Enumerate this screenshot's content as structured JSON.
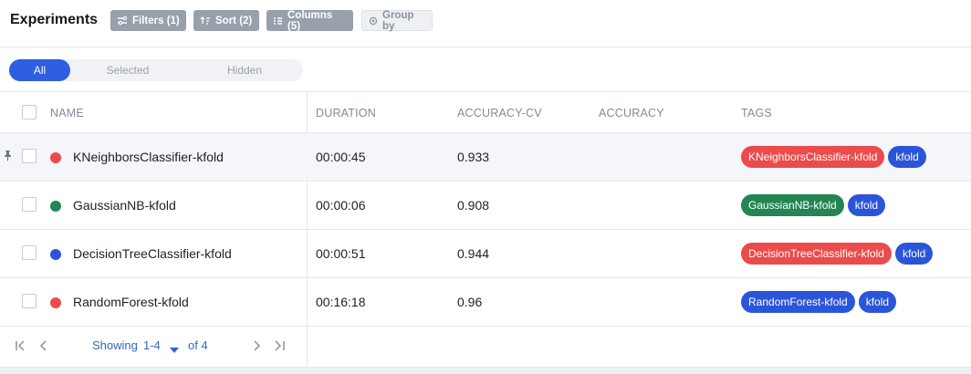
{
  "header": {
    "title": "Experiments",
    "filters_label": "Filters (1)",
    "sort_label": "Sort (2)",
    "columns_label": "Columns (5)",
    "group_by_label": "Group by"
  },
  "segment": {
    "all": "All",
    "selected": "Selected",
    "hidden": "Hidden",
    "active": "All"
  },
  "columns": {
    "name": "NAME",
    "duration": "DURATION",
    "accuracy_cv": "ACCURACY-CV",
    "accuracy": "ACCURACY",
    "tags": "TAGS"
  },
  "rows": [
    {
      "name": "KNeighborsClassifier-kfold",
      "duration": "00:00:45",
      "accuracy_cv": "0.933",
      "accuracy": "",
      "dot_color": "#eb4b4b",
      "pinned": true,
      "tags": [
        {
          "text": "KNeighborsClassifier-kfold",
          "color": "red"
        },
        {
          "text": "kfold",
          "color": "blue"
        }
      ]
    },
    {
      "name": "GaussianNB-kfold",
      "duration": "00:00:06",
      "accuracy_cv": "0.908",
      "accuracy": "",
      "dot_color": "#238553",
      "pinned": false,
      "tags": [
        {
          "text": "GaussianNB-kfold",
          "color": "green"
        },
        {
          "text": "kfold",
          "color": "blue"
        }
      ]
    },
    {
      "name": "DecisionTreeClassifier-kfold",
      "duration": "00:00:51",
      "accuracy_cv": "0.944",
      "accuracy": "",
      "dot_color": "#2b55d9",
      "pinned": false,
      "tags": [
        {
          "text": "DecisionTreeClassifier-kfold",
          "color": "red"
        },
        {
          "text": "kfold",
          "color": "blue"
        }
      ]
    },
    {
      "name": "RandomForest-kfold",
      "duration": "00:16:18",
      "accuracy_cv": "0.96",
      "accuracy": "",
      "dot_color": "#eb4b4b",
      "pinned": false,
      "tags": [
        {
          "text": "RandomForest-kfold",
          "color": "blue"
        },
        {
          "text": "kfold",
          "color": "blue"
        }
      ]
    }
  ],
  "pagination": {
    "showing_label": "Showing",
    "range": "1-4",
    "of_label": "of 4"
  },
  "icons": {
    "filters": "filter-icon",
    "sort": "sort-icon",
    "columns": "columns-icon",
    "group_by": "group-icon",
    "pin": "pin-icon",
    "first_page": "first-page-icon",
    "prev_page": "prev-page-icon",
    "range_dropdown": "caret-down-icon",
    "next_page": "next-page-icon",
    "last_page": "last-page-icon"
  },
  "colors": {
    "accent": "#2f5ee0",
    "tag_red": "#eb4b4b",
    "tag_green": "#238553",
    "tag_blue": "#2b55d9",
    "toolbar_button": "#98a0ac",
    "link": "#2f6db3"
  }
}
